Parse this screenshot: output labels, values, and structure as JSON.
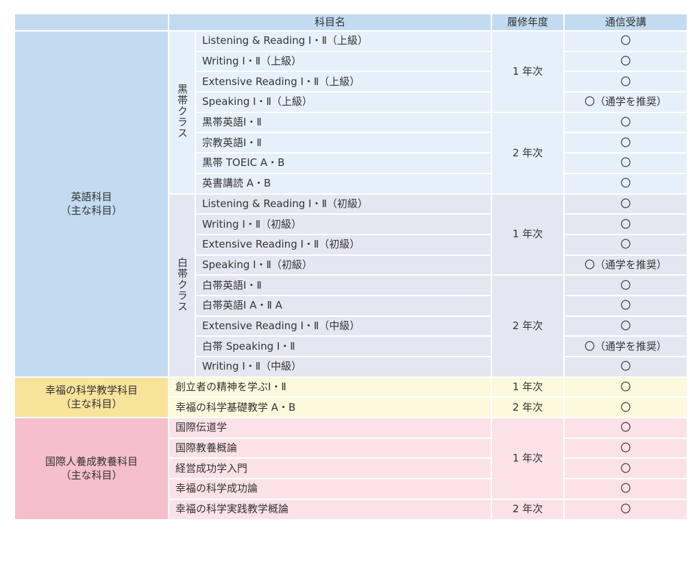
{
  "header": {
    "subject": "科目名",
    "year": "履修年度",
    "correspondence": "通信受講"
  },
  "groups": [
    {
      "category_line1": "英語科目",
      "category_line2": "（主な科目）",
      "classes": [
        {
          "label": "黒帯クラス",
          "years": [
            "1 年次",
            "2 年次"
          ],
          "rows": [
            {
              "subject": "Listening & Reading Ⅰ・Ⅱ（上級）",
              "corr": "〇"
            },
            {
              "subject": "Writing Ⅰ・Ⅱ（上級）",
              "corr": "〇"
            },
            {
              "subject": "Extensive Reading Ⅰ・Ⅱ（上級）",
              "corr": "〇"
            },
            {
              "subject": "Speaking Ⅰ・Ⅱ（上級）",
              "corr": "〇（通学を推奨）"
            },
            {
              "subject": "黒帯英語Ⅰ・Ⅱ",
              "corr": "〇"
            },
            {
              "subject": "宗教英語Ⅰ・Ⅱ",
              "corr": "〇"
            },
            {
              "subject": "黒帯 TOEIC A・B",
              "corr": "〇"
            },
            {
              "subject": "英書講読 A・B",
              "corr": "〇"
            }
          ]
        },
        {
          "label": "白帯クラス",
          "years": [
            "1 年次",
            "2 年次"
          ],
          "rows": [
            {
              "subject": "Listening & Reading Ⅰ・Ⅱ（初級）",
              "corr": "〇"
            },
            {
              "subject": "Writing Ⅰ・Ⅱ（初級）",
              "corr": "〇"
            },
            {
              "subject": "Extensive Reading Ⅰ・Ⅱ（初級）",
              "corr": "〇"
            },
            {
              "subject": "Speaking Ⅰ・Ⅱ（初級）",
              "corr": "〇（通学を推奨）"
            },
            {
              "subject": "白帯英語Ⅰ・Ⅱ",
              "corr": "〇"
            },
            {
              "subject": "白帯英語Ⅰ A・Ⅱ A",
              "corr": "〇"
            },
            {
              "subject": "Extensive Reading Ⅰ・Ⅱ（中級）",
              "corr": "〇"
            },
            {
              "subject": "白帯 Speaking Ⅰ・Ⅱ",
              "corr": "〇（通学を推奨）"
            },
            {
              "subject": "Writing Ⅰ・Ⅱ（中級）",
              "corr": "〇"
            }
          ]
        }
      ]
    },
    {
      "category_line1": "幸福の科学教学科目",
      "category_line2": "（主な科目）",
      "rows": [
        {
          "subject": "創立者の精神を学ぶⅠ・Ⅱ",
          "year": "1 年次",
          "corr": "〇"
        },
        {
          "subject": "幸福の科学基礎教学 A・B",
          "year": "2 年次",
          "corr": "〇"
        }
      ]
    },
    {
      "category_line1": "国際人養成教養科目",
      "category_line2": "（主な科目）",
      "years": [
        "1 年次",
        "2 年次"
      ],
      "rows": [
        {
          "subject": "国際伝道学",
          "corr": "〇"
        },
        {
          "subject": "国際教養概論",
          "corr": "〇"
        },
        {
          "subject": "経営成功学入門",
          "corr": "〇"
        },
        {
          "subject": "幸福の科学成功論",
          "corr": "〇"
        },
        {
          "subject": "幸福の科学実践教学概論",
          "corr": "〇"
        }
      ]
    }
  ]
}
